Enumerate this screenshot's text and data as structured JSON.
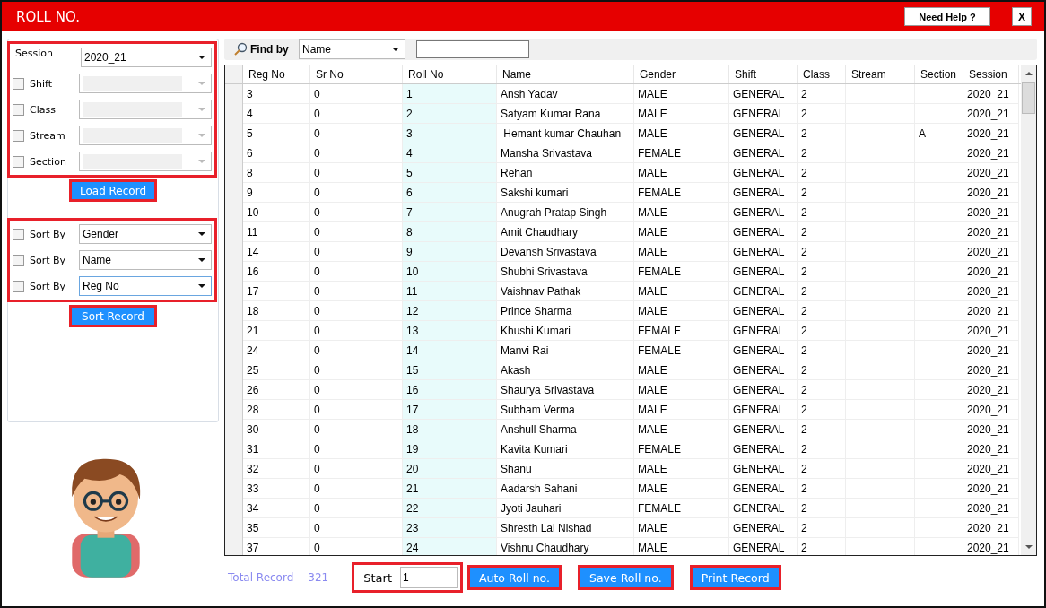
{
  "window": {
    "title": "ROLL NO.",
    "help_button": "Need Help ?",
    "close_button": "X"
  },
  "filter": {
    "session": {
      "label": "Session",
      "value": "2020_21"
    },
    "options": [
      {
        "label": "Shift",
        "checked": false,
        "disabled": true
      },
      {
        "label": "Class",
        "checked": false,
        "disabled": true
      },
      {
        "label": "Stream",
        "checked": false,
        "disabled": true
      },
      {
        "label": "Section",
        "checked": false,
        "disabled": true
      }
    ],
    "button": "Load Record"
  },
  "sort": {
    "options": [
      {
        "label": "Sort By",
        "checked": false,
        "value": "Gender"
      },
      {
        "label": "Sort By",
        "checked": false,
        "value": "Name"
      },
      {
        "label": "Sort By",
        "checked": false,
        "value": "Reg No"
      }
    ],
    "button": "Sort Record"
  },
  "find": {
    "label": "Find by",
    "field": "Name"
  },
  "table": {
    "columns": [
      "Reg No",
      "Sr No",
      "Roll No",
      "Name",
      "Gender",
      "Shift",
      "Class",
      "Stream",
      "Section",
      "Session"
    ],
    "rows": [
      [
        "3",
        "0",
        "1",
        "Ansh Yadav",
        "MALE",
        "GENERAL",
        "2",
        "",
        "",
        "2020_21"
      ],
      [
        "4",
        "0",
        "2",
        "Satyam Kumar Rana",
        "MALE",
        "GENERAL",
        "2",
        "",
        "",
        "2020_21"
      ],
      [
        "5",
        "0",
        "3",
        " Hemant kumar Chauhan",
        "MALE",
        "GENERAL",
        "2",
        "",
        "A",
        "2020_21"
      ],
      [
        "6",
        "0",
        "4",
        "Mansha Srivastava",
        "FEMALE",
        "GENERAL",
        "2",
        "",
        "",
        "2020_21"
      ],
      [
        "8",
        "0",
        "5",
        "Rehan",
        "MALE",
        "GENERAL",
        "2",
        "",
        "",
        "2020_21"
      ],
      [
        "9",
        "0",
        "6",
        "Sakshi kumari",
        "FEMALE",
        "GENERAL",
        "2",
        "",
        "",
        "2020_21"
      ],
      [
        "10",
        "0",
        "7",
        "Anugrah Pratap Singh",
        "MALE",
        "GENERAL",
        "2",
        "",
        "",
        "2020_21"
      ],
      [
        "11",
        "0",
        "8",
        "Amit Chaudhary",
        "MALE",
        "GENERAL",
        "2",
        "",
        "",
        "2020_21"
      ],
      [
        "14",
        "0",
        "9",
        "Devansh Srivastava",
        "MALE",
        "GENERAL",
        "2",
        "",
        "",
        "2020_21"
      ],
      [
        "16",
        "0",
        "10",
        "Shubhi Srivastava",
        "FEMALE",
        "GENERAL",
        "2",
        "",
        "",
        "2020_21"
      ],
      [
        "17",
        "0",
        "11",
        "Vaishnav Pathak",
        "MALE",
        "GENERAL",
        "2",
        "",
        "",
        "2020_21"
      ],
      [
        "18",
        "0",
        "12",
        "Prince Sharma",
        "MALE",
        "GENERAL",
        "2",
        "",
        "",
        "2020_21"
      ],
      [
        "21",
        "0",
        "13",
        "Khushi Kumari",
        "FEMALE",
        "GENERAL",
        "2",
        "",
        "",
        "2020_21"
      ],
      [
        "24",
        "0",
        "14",
        "Manvi Rai",
        "FEMALE",
        "GENERAL",
        "2",
        "",
        "",
        "2020_21"
      ],
      [
        "25",
        "0",
        "15",
        "Akash",
        "MALE",
        "GENERAL",
        "2",
        "",
        "",
        "2020_21"
      ],
      [
        "26",
        "0",
        "16",
        "Shaurya Srivastava",
        "MALE",
        "GENERAL",
        "2",
        "",
        "",
        "2020_21"
      ],
      [
        "28",
        "0",
        "17",
        "Subham Verma",
        "MALE",
        "GENERAL",
        "2",
        "",
        "",
        "2020_21"
      ],
      [
        "30",
        "0",
        "18",
        "Anshull Sharma",
        "MALE",
        "GENERAL",
        "2",
        "",
        "",
        "2020_21"
      ],
      [
        "31",
        "0",
        "19",
        "Kavita Kumari",
        "FEMALE",
        "GENERAL",
        "2",
        "",
        "",
        "2020_21"
      ],
      [
        "32",
        "0",
        "20",
        "Shanu",
        "MALE",
        "GENERAL",
        "2",
        "",
        "",
        "2020_21"
      ],
      [
        "33",
        "0",
        "21",
        "Aadarsh Sahani",
        "MALE",
        "GENERAL",
        "2",
        "",
        "",
        "2020_21"
      ],
      [
        "34",
        "0",
        "22",
        "Jyoti Jauhari",
        "FEMALE",
        "GENERAL",
        "2",
        "",
        "",
        "2020_21"
      ],
      [
        "35",
        "0",
        "23",
        "Shresth Lal Nishad",
        "MALE",
        "GENERAL",
        "2",
        "",
        "",
        "2020_21"
      ],
      [
        "37",
        "0",
        "24",
        "Vishnu Chaudhary",
        "MALE",
        "GENERAL",
        "2",
        "",
        "",
        "2020_21"
      ]
    ]
  },
  "footer": {
    "total_label": "Total Record",
    "total": "321",
    "start_label": "Start",
    "start_value": "1",
    "buttons": [
      "Auto Roll no.",
      "Save Roll no.",
      "Print Record"
    ]
  }
}
